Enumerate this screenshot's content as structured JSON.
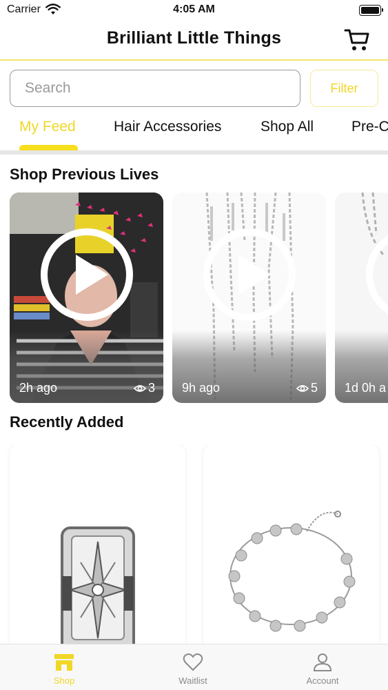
{
  "status_bar": {
    "carrier": "Carrier",
    "time": "4:05 AM"
  },
  "header": {
    "title": "Brilliant Little Things",
    "cart_icon": "cart-icon"
  },
  "search": {
    "placeholder": "Search",
    "value": "",
    "filter_label": "Filter"
  },
  "tabs": [
    {
      "label": "My Feed",
      "active": true
    },
    {
      "label": "Hair Accessories",
      "active": false
    },
    {
      "label": "Shop All",
      "active": false
    },
    {
      "label": "Pre-C",
      "active": false
    }
  ],
  "sections": {
    "previous_lives_title": "Shop Previous Lives",
    "recently_added_title": "Recently Added"
  },
  "lives": [
    {
      "ago": "2h ago",
      "views": "3"
    },
    {
      "ago": "9h ago",
      "views": "5"
    },
    {
      "ago": "1d 0h a",
      "views": ""
    }
  ],
  "products": [
    {
      "image": "silver-ring-photo"
    },
    {
      "image": "silver-star-chain-bracelet-photo"
    }
  ],
  "tab_bar": [
    {
      "label": "Shop",
      "icon": "shop-icon",
      "active": true
    },
    {
      "label": "Waitlist",
      "icon": "heart-icon",
      "active": false
    },
    {
      "label": "Account",
      "icon": "person-icon",
      "active": false
    }
  ],
  "colors": {
    "accent": "#f0d726",
    "indicator": "#f7df1e",
    "divider": "#e6e6e6"
  }
}
